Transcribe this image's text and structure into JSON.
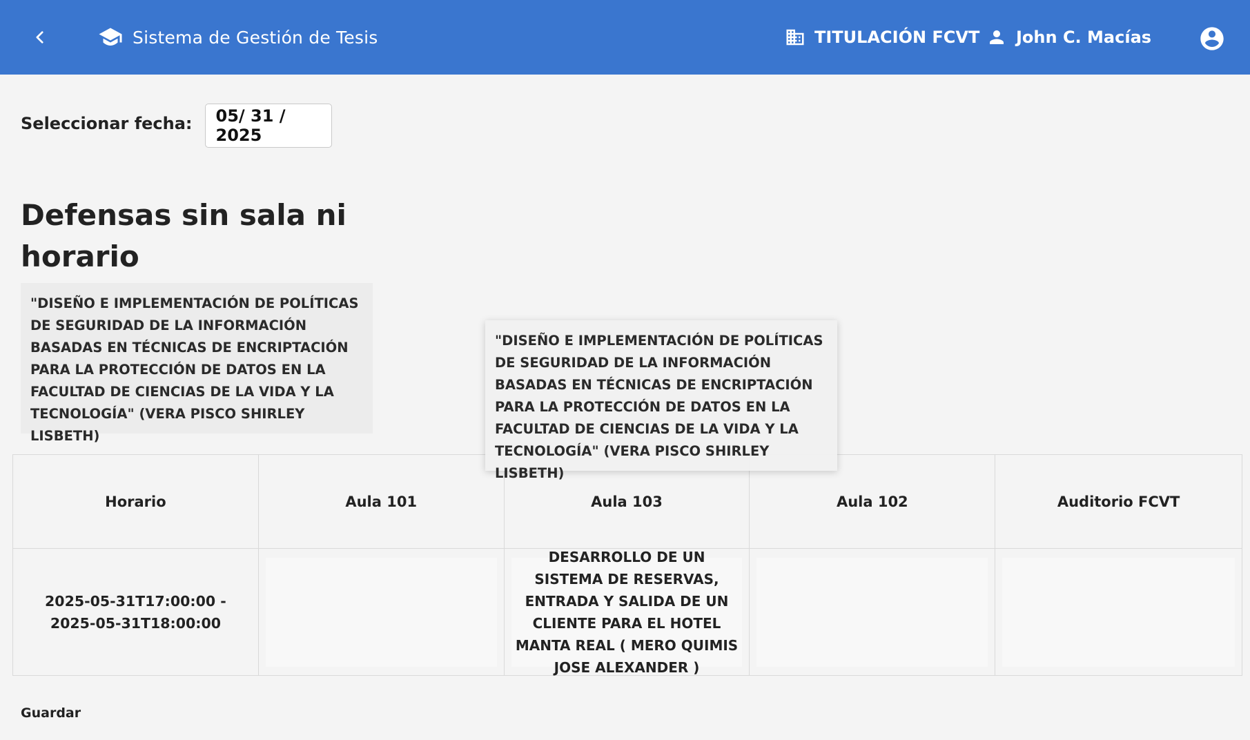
{
  "header": {
    "back_icon": "chevron-left-icon",
    "brand_icon": "graduation-cap-icon",
    "app_title": "Sistema de Gestión de Tesis",
    "faculty_icon": "building-icon",
    "faculty": "TITULACIÓN FCVT",
    "user_icon": "person-icon",
    "user_name": "John C. Macías",
    "account_icon": "account-circle-icon",
    "bar_color": "#3a76cf"
  },
  "date_picker": {
    "label": "Seleccionar fecha:",
    "value": "05/ 31 / 2025"
  },
  "unassigned": {
    "title": "Defensas sin sala ni horario",
    "items": [
      "\"DISEÑO E IMPLEMENTACIÓN DE POLÍTICAS DE SEGURIDAD DE LA INFORMACIÓN BASADAS EN TÉCNICAS DE ENCRIPTACIÓN PARA LA PROTECCIÓN DE DATOS EN LA FACULTAD DE CIENCIAS DE LA VIDA Y LA TECNOLOGÍA\" (VERA PISCO SHIRLEY LISBETH)"
    ]
  },
  "drag_preview": "\"DISEÑO E IMPLEMENTACIÓN DE POLÍTICAS DE SEGURIDAD DE LA INFORMACIÓN BASADAS EN TÉCNICAS DE ENCRIPTACIÓN PARA LA PROTECCIÓN DE DATOS EN LA FACULTAD DE CIENCIAS DE LA VIDA Y LA TECNOLOGÍA\" (VERA PISCO SHIRLEY LISBETH)",
  "schedule": {
    "columns": [
      "Horario",
      "Aula 101",
      "Aula 103",
      "Aula 102",
      "Auditorio FCVT"
    ],
    "rows": [
      {
        "time": "2025-05-31T17:00:00 - 2025-05-31T18:00:00",
        "slots": [
          "",
          "DESARROLLO DE UN SISTEMA DE RESERVAS, ENTRADA Y SALIDA DE UN CLIENTE PARA EL HOTEL MANTA REAL ( MERO QUIMIS JOSE ALEXANDER )",
          "",
          ""
        ]
      }
    ]
  },
  "actions": {
    "save_label": "Guardar"
  }
}
